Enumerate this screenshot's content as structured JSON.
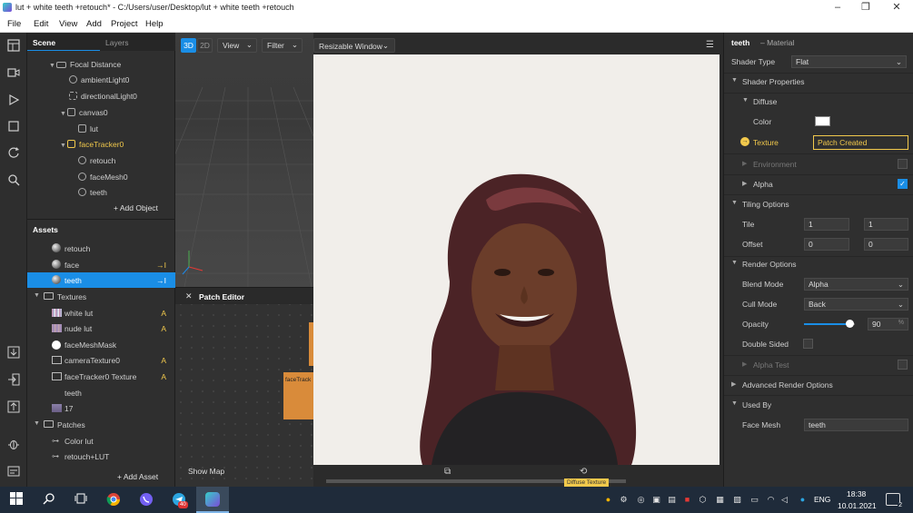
{
  "window": {
    "title": "lut + white teeth +retouch* - C:/Users/user/Desktop/lut + white teeth +retouch",
    "controls": {
      "minimize": "–",
      "maximize": "❐",
      "close": "✕"
    }
  },
  "menu": [
    "File",
    "Edit",
    "View",
    "Add",
    "Project",
    "Help"
  ],
  "scene": {
    "tabs": {
      "scene": "Scene",
      "layers": "Layers"
    },
    "items": [
      "Focal Distance",
      "ambientLight0",
      "directionalLight0",
      "canvas0",
      "lut",
      "faceTracker0",
      "retouch",
      "faceMesh0",
      "teeth"
    ],
    "add_object": "+ Add Object"
  },
  "assets": {
    "title": "Assets",
    "materials": [
      {
        "label": "retouch",
        "badge": ""
      },
      {
        "label": "face",
        "badge": "→I"
      },
      {
        "label": "teeth",
        "badge": "→I"
      }
    ],
    "textures_folder": "Textures",
    "textures": [
      {
        "label": "white lut",
        "badge": "A"
      },
      {
        "label": "nude lut",
        "badge": "A"
      },
      {
        "label": "faceMeshMask",
        "badge": ""
      },
      {
        "label": "cameraTexture0",
        "badge": "A"
      },
      {
        "label": "faceTracker0 Texture",
        "badge": "A"
      },
      {
        "label": "teeth",
        "badge": ""
      },
      {
        "label": "17",
        "badge": ""
      }
    ],
    "patches_folder": "Patches",
    "patches": [
      "Color lut",
      "retouch+LUT"
    ],
    "add_asset": "+ Add Asset"
  },
  "viewport": {
    "btn3d": "3D",
    "btn2d": "2D",
    "view": "View",
    "filter": "Filter"
  },
  "patch_editor": {
    "title": "Patch Editor",
    "node_label": "faceTrack",
    "show_map": "Show Map"
  },
  "simulator": {
    "device": "Resizable Window",
    "bottom_label": "Diffuse Texture"
  },
  "inspector": {
    "object_name": "teeth",
    "object_type": "– Material",
    "shader_type_label": "Shader Type",
    "shader_type_value": "Flat",
    "shader_properties": "Shader Properties",
    "diffuse": "Diffuse",
    "color_label": "Color",
    "color_value": "#ffffff",
    "texture_label": "Texture",
    "texture_value": "Patch Created",
    "environment": "Environment",
    "alpha": "Alpha",
    "tiling_options": "Tiling Options",
    "tile_label": "Tile",
    "tile_x": "1",
    "tile_y": "1",
    "offset_label": "Offset",
    "offset_x": "0",
    "offset_y": "0",
    "render_options": "Render Options",
    "blend_mode_label": "Blend Mode",
    "blend_mode_value": "Alpha",
    "cull_mode_label": "Cull Mode",
    "cull_mode_value": "Back",
    "opacity_label": "Opacity",
    "opacity_value": "90",
    "opacity_unit": "%",
    "double_sided": "Double Sided",
    "alpha_test": "Alpha Test",
    "advanced_render_options": "Advanced Render Options",
    "used_by": "Used By",
    "face_mesh_label": "Face Mesh",
    "face_mesh_value": "teeth"
  },
  "taskbar": {
    "language": "ENG",
    "time": "18:38",
    "date": "10.01.2021",
    "notification_count": "2",
    "telegram_badge": "40"
  },
  "colors": {
    "accent": "#1a8ee6",
    "highlight": "#f2c94c",
    "panel": "#2f2f2f",
    "taskbar": "#1f2b3a"
  }
}
